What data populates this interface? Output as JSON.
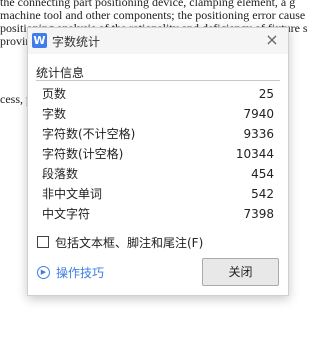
{
  "document": {
    "lines": [
      "the connecting part positioning device, clamping element, a g",
      "machine tool and other components; the positioning error cause",
      "positioning analysis of the rationality and deficiency of fixture s",
      "proving",
      "cess, p"
    ]
  },
  "dialog": {
    "title": "字数统计",
    "app_icon": "W",
    "close_glyph": "×",
    "section_title": "统计信息",
    "stats": [
      {
        "label": "页数",
        "value": "25"
      },
      {
        "label": "字数",
        "value": "7940"
      },
      {
        "label": "字符数(不计空格)",
        "value": "9336"
      },
      {
        "label": "字符数(计空格)",
        "value": "10344"
      },
      {
        "label": "段落数",
        "value": "454"
      },
      {
        "label": "非中文单词",
        "value": "542"
      },
      {
        "label": "中文字符",
        "value": "7398"
      }
    ],
    "option_label": "包括文本框、脚注和尾注(F)",
    "option_checked": false,
    "tips_label": "操作技巧",
    "tips_icon": "play-circle-icon",
    "close_button_label": "关闭",
    "accent_color": "#3d7de0"
  }
}
